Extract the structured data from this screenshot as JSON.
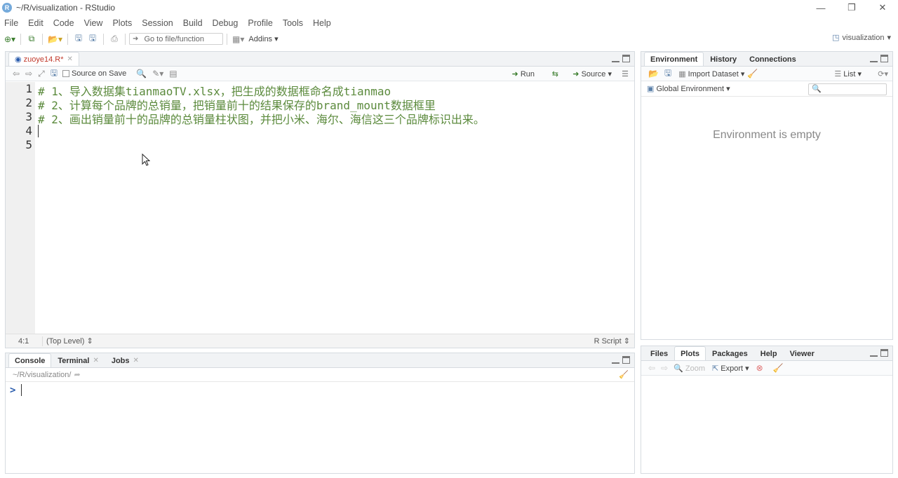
{
  "window": {
    "title": "~/R/visualization - RStudio",
    "app_icon": "R",
    "controls": [
      "—",
      "❐",
      "✕"
    ]
  },
  "menu": [
    "File",
    "Edit",
    "Code",
    "View",
    "Plots",
    "Session",
    "Build",
    "Debug",
    "Profile",
    "Tools",
    "Help"
  ],
  "toolbar": {
    "goto_placeholder": "Go to file/function",
    "addins": "Addins",
    "project": "visualization"
  },
  "editor": {
    "tab_label": "zuoye14.R*",
    "source_on_save": "Source on Save",
    "run": "Run",
    "source": "Source",
    "lines": [
      "# 1、导入数据集tianmaoTV.xlsx，把生成的数据框命名成tianmao",
      "# 2、计算每个品牌的总销量，把销量前十的结果保存的brand_mount数据框里",
      "# 2、画出销量前十的品牌的总销量柱状图，并把小米、海尔、海信这三个品牌标识出来。",
      "",
      ""
    ],
    "line_numbers": [
      "1",
      "2",
      "3",
      "4",
      "5"
    ],
    "position": "4:1",
    "scope": "(Top Level)",
    "file_type": "R Script"
  },
  "console": {
    "tabs": [
      "Console",
      "Terminal",
      "Jobs"
    ],
    "path": "~/R/visualization/",
    "prompt": ">"
  },
  "environment": {
    "tabs": [
      "Environment",
      "History",
      "Connections"
    ],
    "import_dataset": "Import Dataset",
    "list_view": "List",
    "global_env": "Global Environment",
    "empty_message": "Environment is empty"
  },
  "files": {
    "tabs": [
      "Files",
      "Plots",
      "Packages",
      "Help",
      "Viewer"
    ],
    "zoom": "Zoom",
    "export": "Export"
  }
}
